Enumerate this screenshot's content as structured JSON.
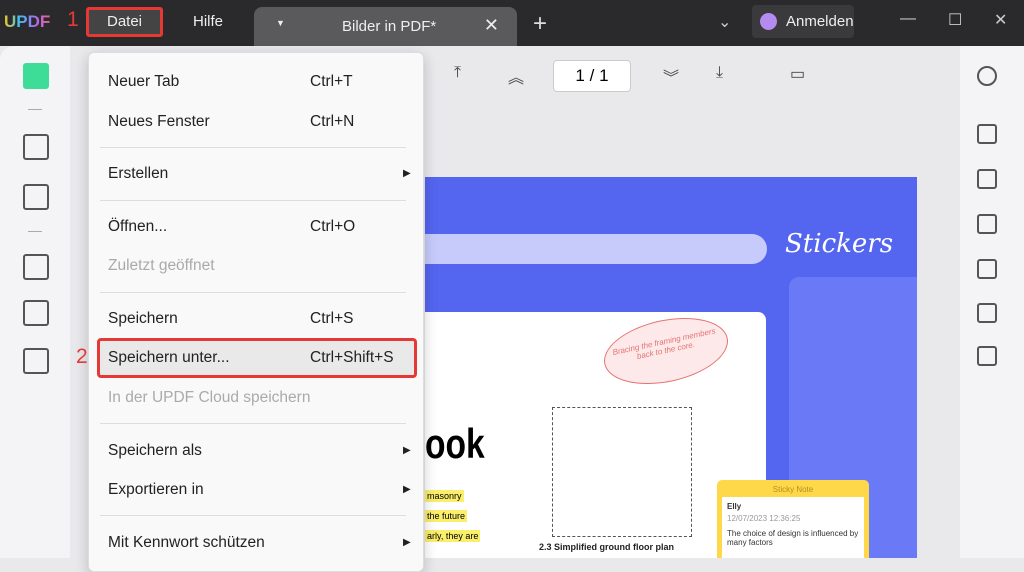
{
  "app": {
    "logo": "UPDF",
    "step1": "1",
    "step2": "2"
  },
  "menubar": {
    "file": "Datei",
    "help": "Hilfe"
  },
  "tab": {
    "title": "Bilder in PDF*"
  },
  "account": {
    "login": "Anmelden"
  },
  "pager": {
    "current": "1",
    "total": "1",
    "separator": "/"
  },
  "file_menu": [
    {
      "label": "Neuer Tab",
      "shortcut": "Ctrl+T"
    },
    {
      "label": "Neues Fenster",
      "shortcut": "Ctrl+N"
    },
    {
      "label": "Erstellen",
      "submenu": true
    },
    {
      "label": "Öffnen...",
      "shortcut": "Ctrl+O"
    },
    {
      "label": "Zuletzt geöffnet",
      "disabled": true
    },
    {
      "label": "Speichern",
      "shortcut": "Ctrl+S"
    },
    {
      "label": "Speichern unter...",
      "shortcut": "Ctrl+Shift+S",
      "highlighted": true
    },
    {
      "label": "In der UPDF Cloud speichern",
      "disabled": true
    },
    {
      "label": "Speichern als",
      "submenu": true
    },
    {
      "label": "Exportieren in",
      "submenu": true
    },
    {
      "label": "Mit Kennwort schützen",
      "submenu": true
    }
  ],
  "document": {
    "stickers_title": "Stickers",
    "heading_fragment": "ook",
    "highlights": [
      "masonry",
      "the future",
      "arly, they are"
    ],
    "callout": "Bracing the framing members back to the core.",
    "plan_caption": "2.3  Simplified ground floor plan",
    "sticky_note": {
      "header": "Sticky Note",
      "author": "Elly",
      "date": "12/07/2023 12:36:25",
      "text": "The choice of design is influenced by many factors"
    }
  },
  "colors": {
    "accent": "#e53935",
    "canvas": "#5465f0",
    "titlebar": "#2a2a2c"
  }
}
